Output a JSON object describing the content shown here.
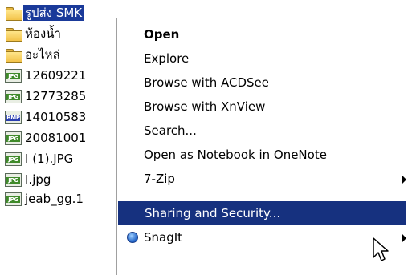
{
  "files": [
    {
      "name": "รูปส่ง SMK",
      "type": "folder",
      "selected": true
    },
    {
      "name": "ห้องน้ำ",
      "type": "folder"
    },
    {
      "name": "อะไหล่",
      "type": "folder"
    },
    {
      "name": "12609221",
      "type": "jpg",
      "badge": "JPG"
    },
    {
      "name": "12773285",
      "type": "jpg",
      "badge": "JPG"
    },
    {
      "name": "14010583",
      "type": "bmp",
      "badge": "BMP"
    },
    {
      "name": "20081001",
      "type": "jpg",
      "badge": "JPG"
    },
    {
      "name": "I (1).JPG",
      "type": "jpg",
      "badge": "JPG"
    },
    {
      "name": "I.jpg",
      "type": "jpg",
      "badge": "JPG"
    },
    {
      "name": "jeab_gg.1",
      "type": "jpg",
      "badge": "JPG"
    }
  ],
  "context_menu": {
    "items": [
      {
        "label": "Open",
        "bold": true
      },
      {
        "label": "Explore"
      },
      {
        "label": "Browse with ACDSee"
      },
      {
        "label": "Browse with XnView"
      },
      {
        "label": "Search..."
      },
      {
        "label": "Open as Notebook in OneNote"
      },
      {
        "label": "7-Zip",
        "submenu": true
      },
      {
        "label": "Sharing and Security...",
        "highlighted": true
      },
      {
        "label": "SnagIt",
        "submenu": true,
        "icon": "snagit-icon"
      }
    ]
  },
  "colors": {
    "selection": "#1a3a9a",
    "menu_highlight": "#16317f",
    "jpg_badge": "#3f8a2a",
    "bmp_badge": "#2a3fb0",
    "folder": "#f3c34a"
  }
}
